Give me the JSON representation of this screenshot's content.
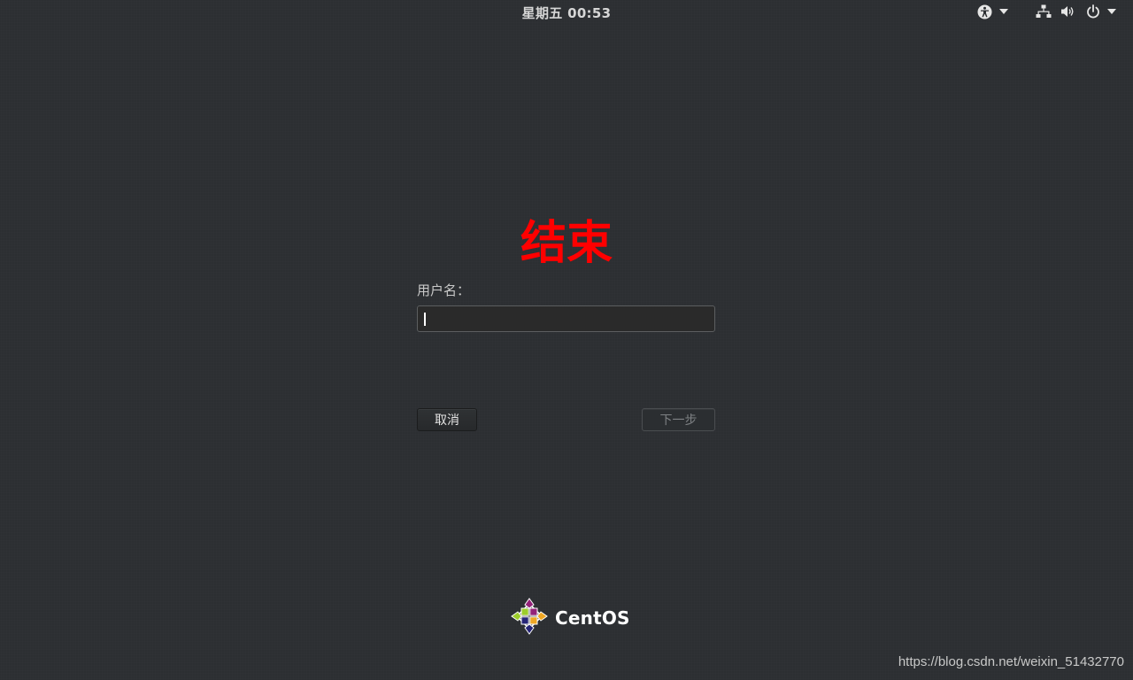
{
  "topbar": {
    "clock": "星期五 00:53",
    "icons": [
      "accessibility-icon",
      "chevron-down-icon",
      "network-icon",
      "volume-icon",
      "power-icon",
      "chevron-down-icon"
    ]
  },
  "login": {
    "heading": "结束",
    "heading_color": "#ff0000",
    "username_label": "用户名：",
    "username_value": "",
    "cancel_label": "取消",
    "next_label": "下一步"
  },
  "branding": {
    "logo_text": "CentOS",
    "logo_icon": "centos-logo-icon"
  },
  "watermark": "https://blog.csdn.net/weixin_51432770"
}
